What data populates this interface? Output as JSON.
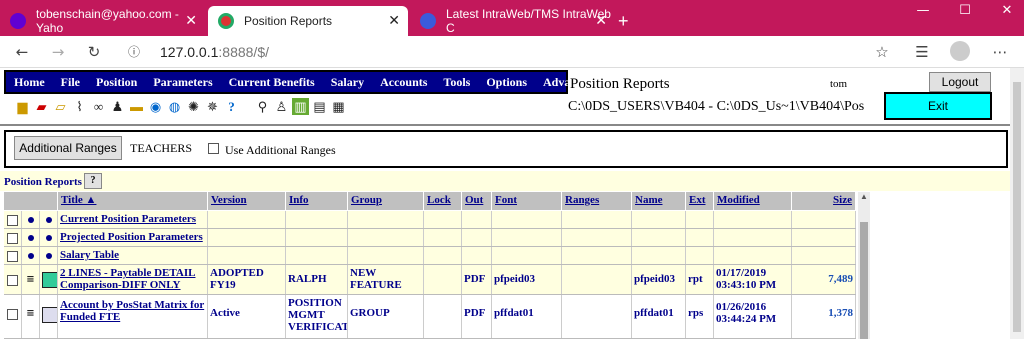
{
  "browser": {
    "tabs": [
      {
        "title": "tobenschain@yahoo.com - Yaho",
        "close": "✕"
      },
      {
        "title": "Position Reports",
        "close": "✕"
      },
      {
        "title": "Latest IntraWeb/TMS IntraWeb C",
        "close": "✕"
      }
    ],
    "new_tab": "+",
    "url_host": "127.0.0.1",
    "url_rest": ":8888/$/",
    "window_controls": {
      "minimize": "—",
      "maximize": "☐",
      "close": "✕"
    }
  },
  "menu": [
    "Home",
    "File",
    "Position",
    "Parameters",
    "Current Benefits",
    "Salary",
    "Accounts",
    "Tools",
    "Options",
    "Advanced"
  ],
  "header": {
    "title": "Position Reports",
    "user": "tom",
    "path": "C:\\0DS_USERS\\VB404 - C:\\0DS_Us~1\\VB404\\Pos",
    "logout": "Logout",
    "exit": "Exit"
  },
  "ranges": {
    "button": "Additional Ranges",
    "group": "TEACHERS",
    "checkbox_label": "Use Additional Ranges"
  },
  "section": {
    "title": "Position Reports",
    "help": "?"
  },
  "columns": [
    "Title ▲",
    "Version",
    "Info",
    "Group",
    "Lock",
    "Out",
    "Font",
    "Ranges",
    "Name",
    "Ext",
    "Modified",
    "Size"
  ],
  "rows": [
    {
      "title": "Current Position Parameters",
      "version": "",
      "info": "",
      "group": "",
      "lock": "",
      "out": "",
      "font": "",
      "ranges": "",
      "name": "",
      "ext": "",
      "modified": "",
      "size": ""
    },
    {
      "title": "Projected Position Parameters",
      "version": "",
      "info": "",
      "group": "",
      "lock": "",
      "out": "",
      "font": "",
      "ranges": "",
      "name": "",
      "ext": "",
      "modified": "",
      "size": ""
    },
    {
      "title": "Salary Table",
      "version": "",
      "info": "",
      "group": "",
      "lock": "",
      "out": "",
      "font": "",
      "ranges": "",
      "name": "",
      "ext": "",
      "modified": "",
      "size": ""
    },
    {
      "title": "2 LINES - Paytable DETAIL Comparison-DIFF ONLY",
      "version": "ADOPTED FY19",
      "info": "RALPH",
      "group": "NEW FEATURE",
      "lock": "",
      "out": "PDF",
      "font": "pfpeid03",
      "ranges": "",
      "name": "pfpeid03",
      "ext": "rpt",
      "modified": "01/17/2019 03:43:10 PM",
      "size": "7,489"
    },
    {
      "title": "Account by PosStat Matrix for Funded FTE",
      "version": "Active",
      "info": "POSITION MGMT VERIFICATION",
      "group": "GROUP",
      "lock": "",
      "out": "PDF",
      "font": "pffdat01",
      "ranges": "",
      "name": "pffdat01",
      "ext": "rps",
      "modified": "01/26/2016 03:44:24 PM",
      "size": "1,378"
    }
  ]
}
